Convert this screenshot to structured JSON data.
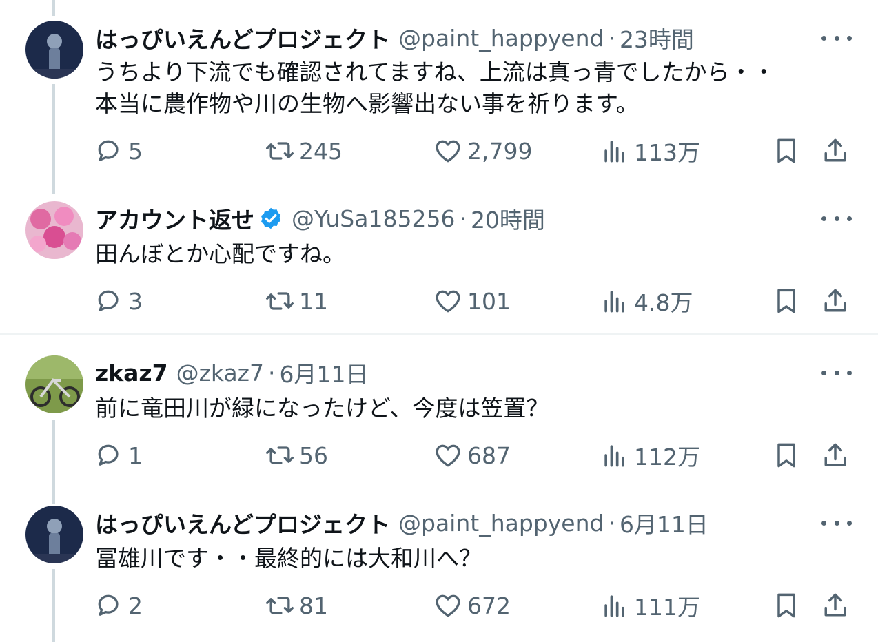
{
  "tweets": [
    {
      "name": "はっぴいえんどプロジェクト",
      "handle": "@paint_happyend",
      "separator": "·",
      "time": "23時間",
      "lines": [
        "うちより下流でも確認されてますね、上流は真っ青でしたから・・",
        "本当に農作物や川の生物へ影響出ない事を祈ります。"
      ],
      "replies": "5",
      "retweets": "245",
      "likes": "2,799",
      "views": "113万",
      "verified": false
    },
    {
      "name": "アカウント返せ",
      "handle": "@YuSa185256",
      "separator": "·",
      "time": "20時間",
      "lines": [
        "田んぼとか心配ですね。"
      ],
      "replies": "3",
      "retweets": "11",
      "likes": "101",
      "views": "4.8万",
      "verified": true
    },
    {
      "name": "zkaz7",
      "handle": "@zkaz7",
      "separator": "·",
      "time": "6月11日",
      "lines": [
        "前に竜田川が緑になったけど、今度は笠置？"
      ],
      "replies": "1",
      "retweets": "56",
      "likes": "687",
      "views": "112万",
      "verified": false
    },
    {
      "name": "はっぴいえんどプロジェクト",
      "handle": "@paint_happyend",
      "separator": "·",
      "time": "6月11日",
      "lines": [
        "冨雄川です・・最終的には大和川へ？"
      ],
      "replies": "2",
      "retweets": "81",
      "likes": "672",
      "views": "111万",
      "verified": false
    }
  ],
  "colors": {
    "text": "#0f1419",
    "muted": "#536471",
    "verified": "#1d9bf0",
    "thread_line": "#cfd9de"
  },
  "icons": [
    "reply-icon",
    "retweet-icon",
    "like-icon",
    "views-icon",
    "bookmark-icon",
    "share-icon",
    "more-icon",
    "verified-icon"
  ]
}
